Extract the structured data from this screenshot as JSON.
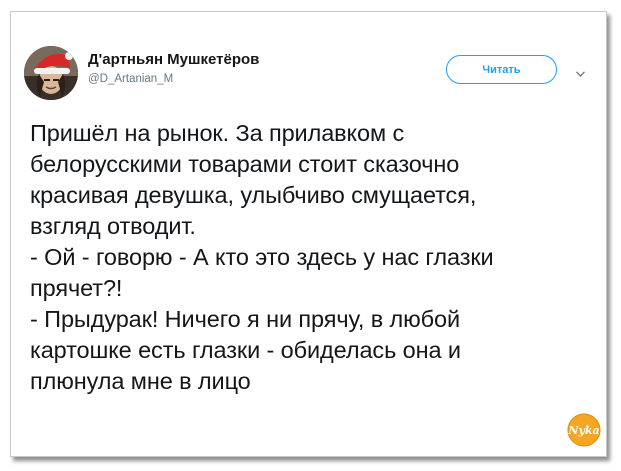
{
  "tweet": {
    "author": {
      "display_name": "Д'артньян Мушкетёров",
      "handle": "@D_Artanian_M",
      "avatar_icon": "user-avatar-santa-hat"
    },
    "follow_button_label": "Читать",
    "menu_icon": "chevron-down-icon",
    "text_lines": [
      "Пришёл на рынок. За прилавком с",
      "белорусскими товарами стоит сказочно",
      "красивая девушка, улыбчиво смущается,",
      "взгляд отводит.",
      "- Ой - говорю - А кто это здесь у нас глазки",
      "прячет?!",
      "- Прыдурак! Ничего я ни прячу, в любой",
      "картошке есть глазки - обиделась она и",
      "плюнула мне в лицо"
    ]
  },
  "watermark": {
    "text": "Nyka",
    "icon": "site-logo-icon"
  },
  "colors": {
    "accent": "#1da1f2",
    "text": "#14171a",
    "secondary_text": "#657786",
    "watermark_fill": "#f5a623"
  }
}
